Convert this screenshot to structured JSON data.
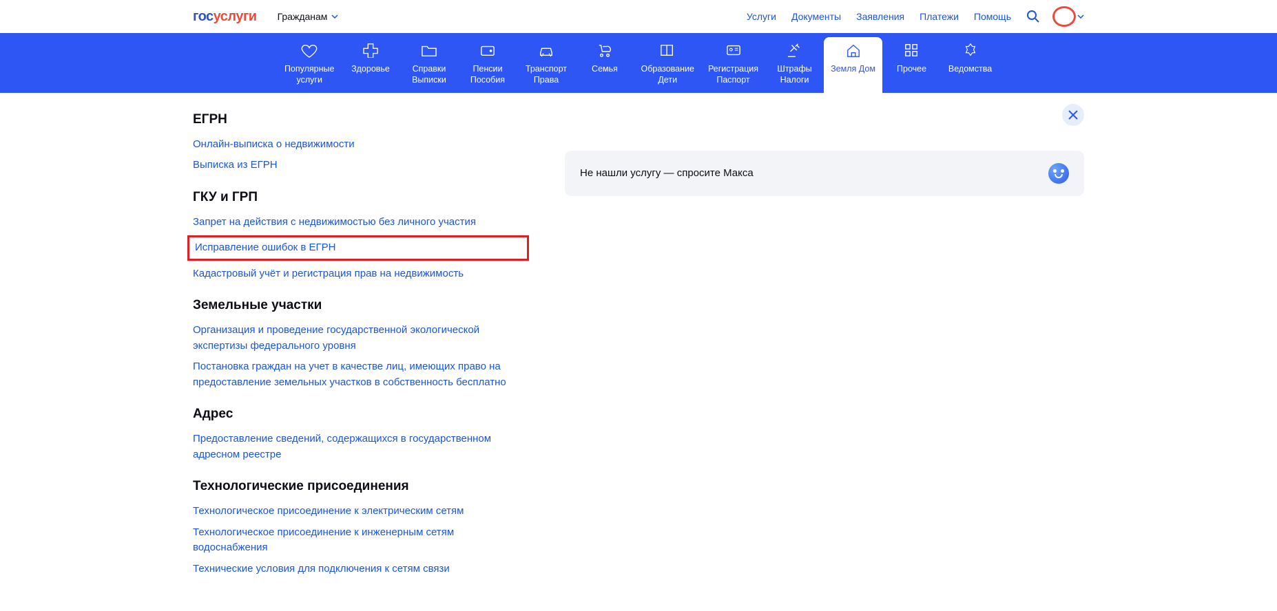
{
  "header": {
    "logo": {
      "part1": "гос",
      "part2": "услуги"
    },
    "audience": "Гражданам",
    "nav": [
      "Услуги",
      "Документы",
      "Заявления",
      "Платежи",
      "Помощь"
    ]
  },
  "categories": [
    {
      "label": "Популярные\nуслуги",
      "icon": "heart"
    },
    {
      "label": "Здоровье",
      "icon": "medical"
    },
    {
      "label": "Справки\nВыписки",
      "icon": "folder"
    },
    {
      "label": "Пенсии\nПособия",
      "icon": "wallet"
    },
    {
      "label": "Транспорт\nПрава",
      "icon": "car"
    },
    {
      "label": "Семья",
      "icon": "stroller"
    },
    {
      "label": "Образование\nДети",
      "icon": "book"
    },
    {
      "label": "Регистрация\nПаспорт",
      "icon": "card"
    },
    {
      "label": "Штрафы\nНалоги",
      "icon": "gavel"
    },
    {
      "label": "Земля Дом",
      "icon": "home",
      "active": true
    },
    {
      "label": "Прочее",
      "icon": "grid"
    },
    {
      "label": "Ведомства",
      "icon": "emblem"
    }
  ],
  "sections": [
    {
      "heading": "ЕГРН",
      "links": [
        {
          "text": "Онлайн-выписка о недвижимости"
        },
        {
          "text": "Выписка из ЕГРН"
        }
      ]
    },
    {
      "heading": "ГКУ и ГРП",
      "links": [
        {
          "text": "Запрет на действия с недвижимостью без личного участия"
        },
        {
          "text": "Исправление ошибок в ЕГРН",
          "highlighted": true
        },
        {
          "text": "Кадастровый учёт и регистрация прав на недвижимость"
        }
      ]
    },
    {
      "heading": "Земельные участки",
      "links": [
        {
          "text": "Организация и проведение государственной экологической экспертизы федерального уровня"
        },
        {
          "text": "Постановка граждан на учет в качестве лиц, имеющих право на предоставление земельных участков в собственность бесплатно"
        }
      ]
    },
    {
      "heading": "Адрес",
      "links": [
        {
          "text": "Предоставление сведений, содержащихся в государственном адресном реестре"
        }
      ]
    },
    {
      "heading": "Технологические присоединения",
      "links": [
        {
          "text": "Технологическое присоединение к электрическим сетям"
        },
        {
          "text": "Технологическое присоединение к инженерным сетям водоснабжения"
        },
        {
          "text": "Технические условия для подключения к сетям связи"
        }
      ]
    }
  ],
  "assistant": {
    "text": "Не нашли услугу — спросите Макса"
  }
}
